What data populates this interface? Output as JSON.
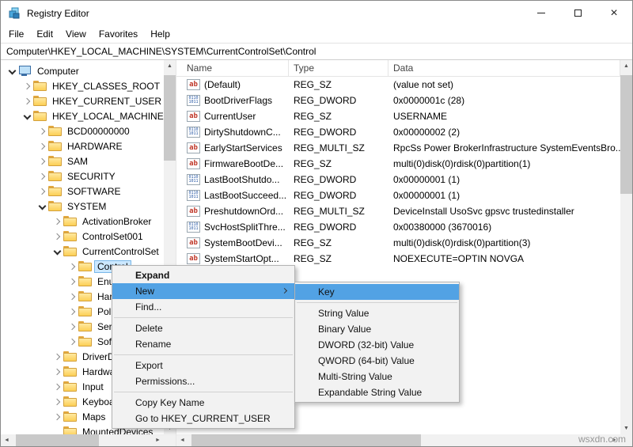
{
  "window": {
    "title": "Registry Editor"
  },
  "menubar": [
    "File",
    "Edit",
    "View",
    "Favorites",
    "Help"
  ],
  "address": "Computer\\HKEY_LOCAL_MACHINE\\SYSTEM\\CurrentControlSet\\Control",
  "tree": {
    "items": [
      {
        "label": "Computer",
        "level": 0,
        "state": "expanded",
        "icon": "computer"
      },
      {
        "label": "HKEY_CLASSES_ROOT",
        "level": 1,
        "state": "collapsed",
        "icon": "folder"
      },
      {
        "label": "HKEY_CURRENT_USER",
        "level": 1,
        "state": "collapsed",
        "icon": "folder"
      },
      {
        "label": "HKEY_LOCAL_MACHINE",
        "level": 1,
        "state": "expanded",
        "icon": "folder"
      },
      {
        "label": "BCD00000000",
        "level": 2,
        "state": "collapsed",
        "icon": "folder"
      },
      {
        "label": "HARDWARE",
        "level": 2,
        "state": "collapsed",
        "icon": "folder"
      },
      {
        "label": "SAM",
        "level": 2,
        "state": "collapsed",
        "icon": "folder"
      },
      {
        "label": "SECURITY",
        "level": 2,
        "state": "collapsed",
        "icon": "folder"
      },
      {
        "label": "SOFTWARE",
        "level": 2,
        "state": "collapsed",
        "icon": "folder"
      },
      {
        "label": "SYSTEM",
        "level": 2,
        "state": "expanded",
        "icon": "folder"
      },
      {
        "label": "ActivationBroker",
        "level": 3,
        "state": "collapsed",
        "icon": "folder"
      },
      {
        "label": "ControlSet001",
        "level": 3,
        "state": "collapsed",
        "icon": "folder"
      },
      {
        "label": "CurrentControlSet",
        "level": 3,
        "state": "expanded",
        "icon": "folder"
      },
      {
        "label": "Control",
        "level": 4,
        "state": "collapsed",
        "icon": "folder",
        "selected": true
      },
      {
        "label": "Enum",
        "level": 4,
        "state": "collapsed",
        "icon": "folder"
      },
      {
        "label": "Hardware Profiles",
        "level": 4,
        "state": "collapsed",
        "icon": "folder"
      },
      {
        "label": "Policies",
        "level": 4,
        "state": "collapsed",
        "icon": "folder"
      },
      {
        "label": "Services",
        "level": 4,
        "state": "collapsed",
        "icon": "folder"
      },
      {
        "label": "Software",
        "level": 4,
        "state": "collapsed",
        "icon": "folder"
      },
      {
        "label": "DriverDatabase",
        "level": 3,
        "state": "collapsed",
        "icon": "folder"
      },
      {
        "label": "HardwareConfig",
        "level": 3,
        "state": "collapsed",
        "icon": "folder"
      },
      {
        "label": "Input",
        "level": 3,
        "state": "collapsed",
        "icon": "folder"
      },
      {
        "label": "Keyboard Layout",
        "level": 3,
        "state": "collapsed",
        "icon": "folder"
      },
      {
        "label": "Maps",
        "level": 3,
        "state": "collapsed",
        "icon": "folder"
      },
      {
        "label": "MountedDevices",
        "level": 3,
        "state": "leaf",
        "icon": "folder"
      }
    ]
  },
  "list": {
    "columns": [
      "Name",
      "Type",
      "Data"
    ],
    "icon_glyphs": {
      "string": "ab",
      "dword": [
        "0110",
        "1011"
      ]
    },
    "rows": [
      {
        "name": "(Default)",
        "type": "REG_SZ",
        "data": "(value not set)",
        "icon": "string"
      },
      {
        "name": "BootDriverFlags",
        "type": "REG_DWORD",
        "data": "0x0000001c (28)",
        "icon": "dword"
      },
      {
        "name": "CurrentUser",
        "type": "REG_SZ",
        "data": "USERNAME",
        "icon": "string"
      },
      {
        "name": "DirtyShutdownC...",
        "type": "REG_DWORD",
        "data": "0x00000002 (2)",
        "icon": "dword"
      },
      {
        "name": "EarlyStartServices",
        "type": "REG_MULTI_SZ",
        "data": "RpcSs Power BrokerInfrastructure SystemEventsBro...",
        "icon": "string"
      },
      {
        "name": "FirmwareBootDe...",
        "type": "REG_SZ",
        "data": "multi(0)disk(0)rdisk(0)partition(1)",
        "icon": "string"
      },
      {
        "name": "LastBootShutdo...",
        "type": "REG_DWORD",
        "data": "0x00000001 (1)",
        "icon": "dword"
      },
      {
        "name": "LastBootSucceed...",
        "type": "REG_DWORD",
        "data": "0x00000001 (1)",
        "icon": "dword"
      },
      {
        "name": "PreshutdownOrd...",
        "type": "REG_MULTI_SZ",
        "data": "DeviceInstall UsoSvc gpsvc trustedinstaller",
        "icon": "string"
      },
      {
        "name": "SvcHostSplitThre...",
        "type": "REG_DWORD",
        "data": "0x00380000 (3670016)",
        "icon": "dword"
      },
      {
        "name": "SystemBootDevi...",
        "type": "REG_SZ",
        "data": "multi(0)disk(0)rdisk(0)partition(3)",
        "icon": "string"
      },
      {
        "name": "SystemStartOpt...",
        "type": "REG_SZ",
        "data": "NOEXECUTE=OPTIN NOVGA",
        "icon": "string"
      }
    ]
  },
  "context_menu": {
    "items": [
      {
        "label": "Expand",
        "bold": true
      },
      {
        "label": "New",
        "highlighted": true,
        "submenu": true
      },
      {
        "label": "Find..."
      },
      {
        "separator": true
      },
      {
        "label": "Delete"
      },
      {
        "label": "Rename"
      },
      {
        "separator": true
      },
      {
        "label": "Export"
      },
      {
        "label": "Permissions..."
      },
      {
        "separator": true
      },
      {
        "label": "Copy Key Name"
      },
      {
        "label": "Go to HKEY_CURRENT_USER"
      }
    ]
  },
  "submenu": {
    "items": [
      {
        "label": "Key",
        "highlighted": true
      },
      {
        "separator": true
      },
      {
        "label": "String Value"
      },
      {
        "label": "Binary Value"
      },
      {
        "label": "DWORD (32-bit) Value"
      },
      {
        "label": "QWORD (64-bit) Value"
      },
      {
        "label": "Multi-String Value"
      },
      {
        "label": "Expandable String Value"
      }
    ]
  },
  "watermark": "wsxdn.com"
}
